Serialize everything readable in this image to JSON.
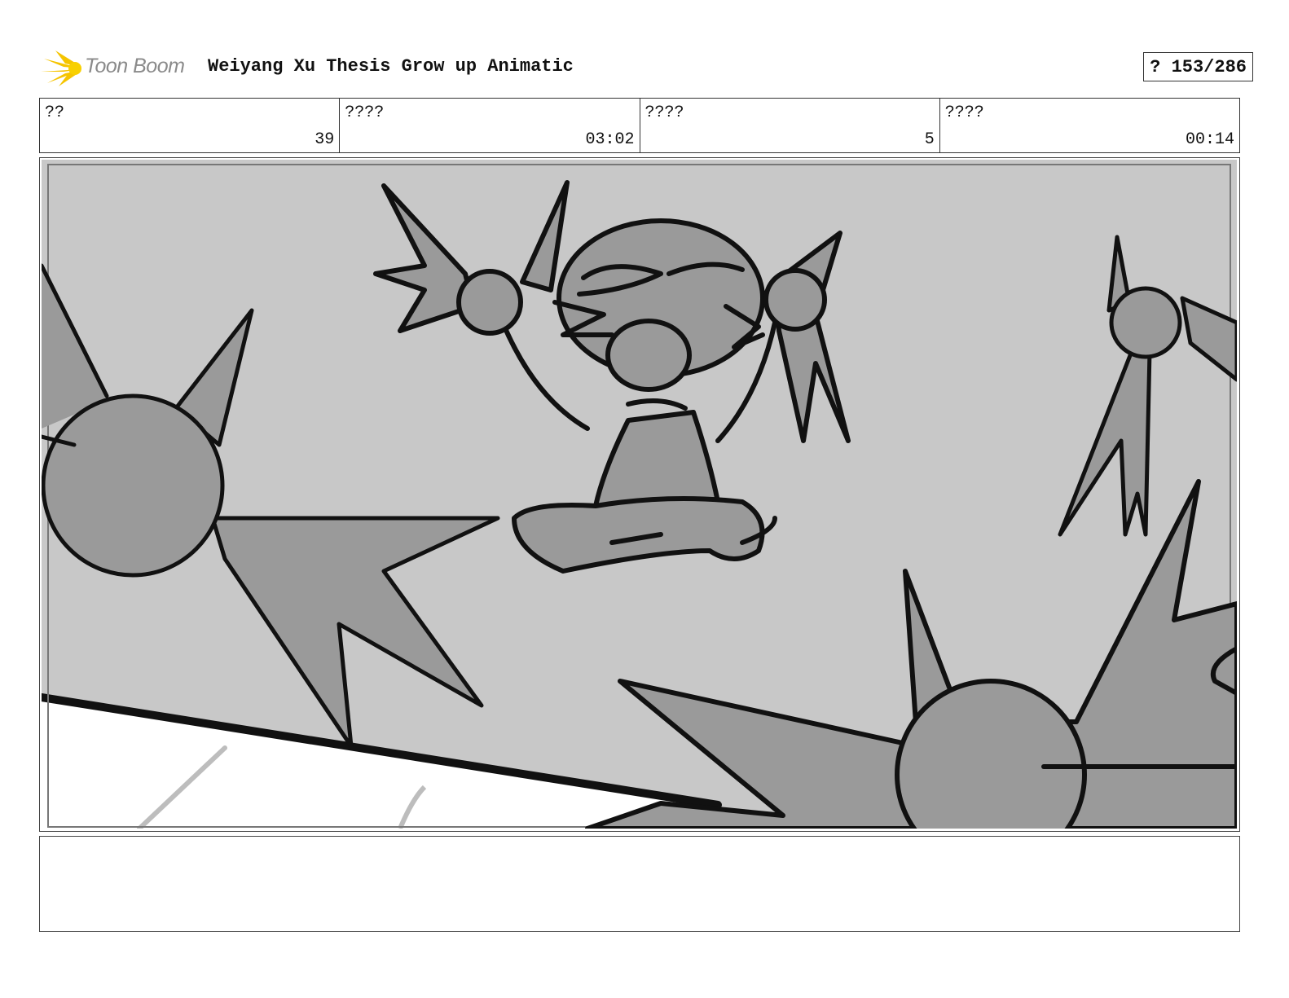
{
  "header": {
    "logo_text": "Toon Boom",
    "title": "Weiyang Xu Thesis Grow up Animatic",
    "page_indicator": "? 153/286"
  },
  "info": [
    {
      "label": "??",
      "value": "39"
    },
    {
      "label": "????",
      "value": "03:02"
    },
    {
      "label": "????",
      "value": "5"
    },
    {
      "label": "????",
      "value": "00:14"
    }
  ],
  "panel": {
    "image": "storyboard-sketch-character-among-spiky-shapes"
  },
  "notes": {
    "text": ""
  },
  "colors": {
    "logo_yellow": "#f5c400",
    "sketch_bg": "#c8c8c8",
    "sketch_fill": "#9a9a9a",
    "sketch_line": "#111111"
  }
}
